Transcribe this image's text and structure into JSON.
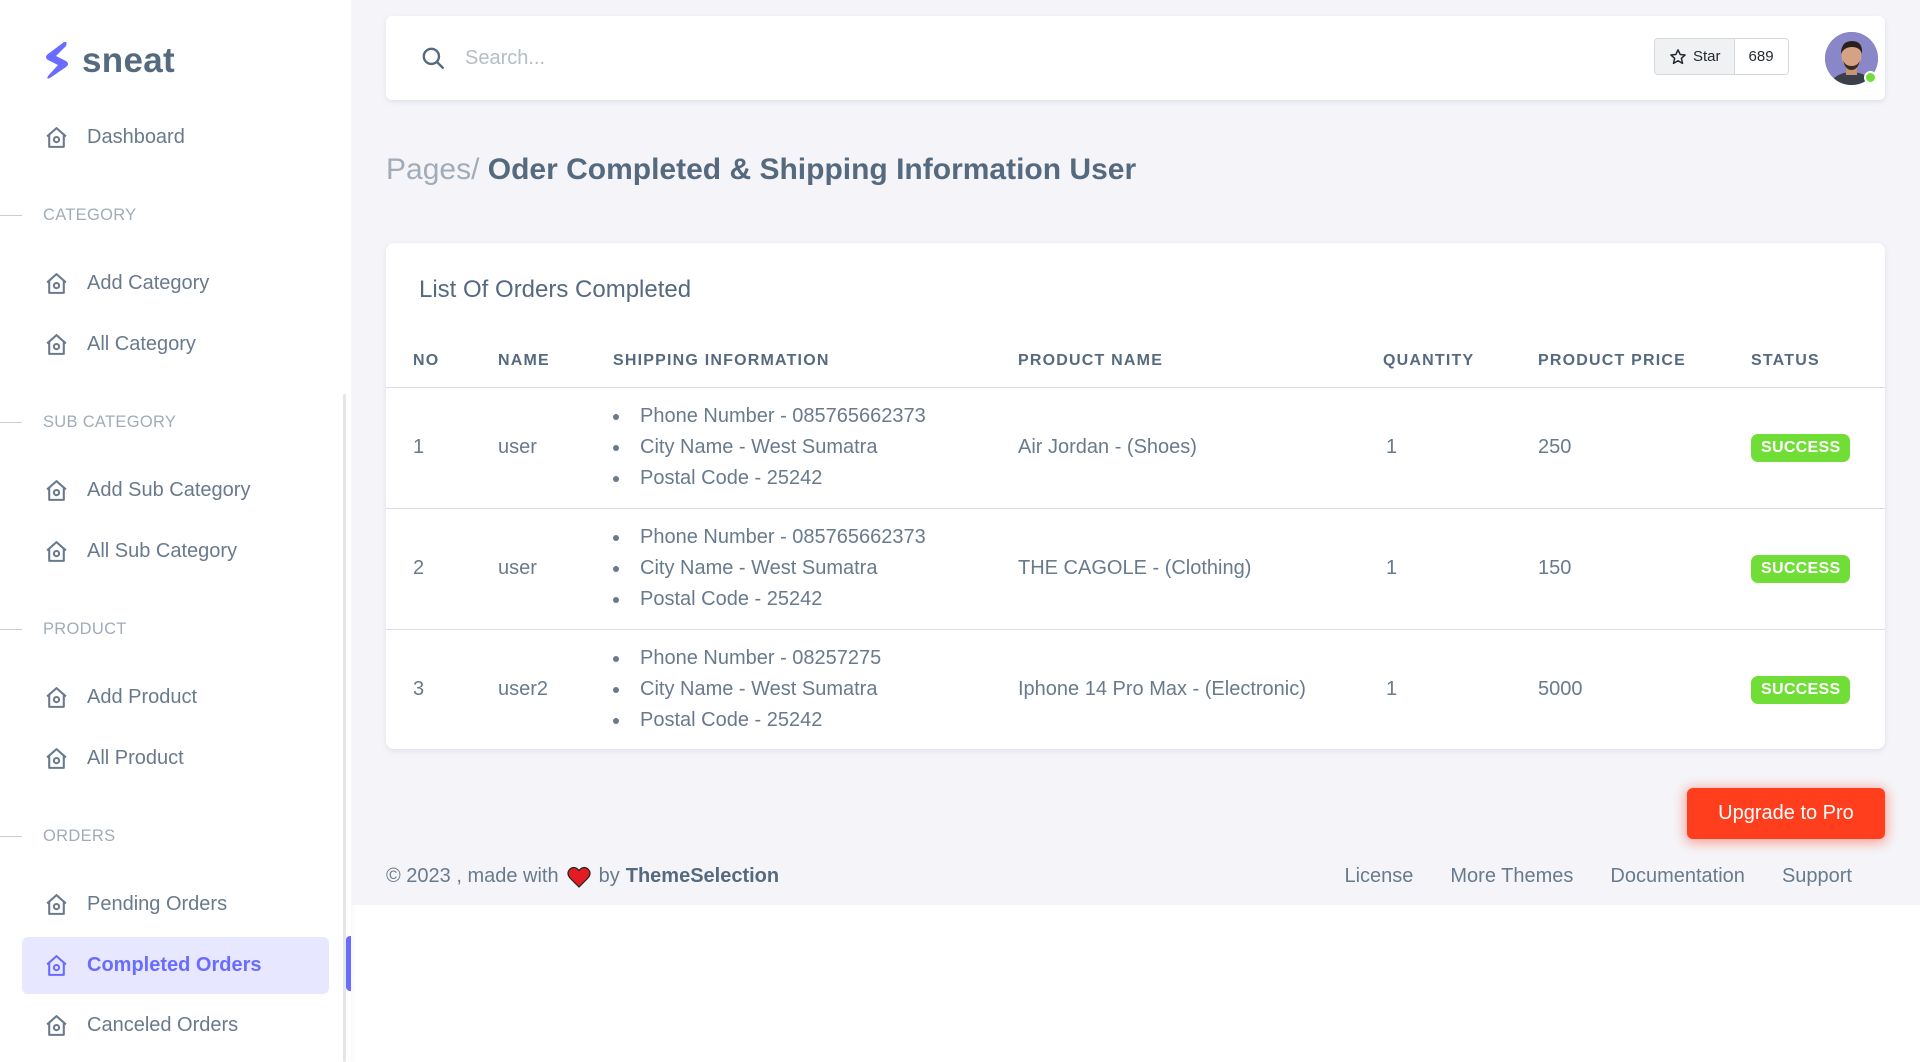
{
  "brand": {
    "name": "sneat"
  },
  "sidebar": {
    "dashboard": "Dashboard",
    "sections": [
      {
        "header": "CATEGORY",
        "items": [
          "Add Category",
          "All Category"
        ]
      },
      {
        "header": "SUB CATEGORY",
        "items": [
          "Add Sub Category",
          "All Sub Category"
        ]
      },
      {
        "header": "PRODUCT",
        "items": [
          "Add Product",
          "All Product"
        ]
      },
      {
        "header": "ORDERS",
        "items": [
          "Pending Orders",
          "Completed Orders",
          "Canceled Orders"
        ]
      }
    ],
    "active_item": "Completed Orders",
    "icon": "home-icon"
  },
  "navbar": {
    "search_placeholder": "Search...",
    "github_star_label": "Star",
    "github_star_count": "689"
  },
  "breadcrumb": {
    "parent": "Pages/",
    "current": "Oder Completed & Shipping Information User"
  },
  "orders_table": {
    "title": "List Of Orders Completed",
    "columns": [
      "NO",
      "NAME",
      "SHIPPING INFORMATION",
      "PRODUCT NAME",
      "QUANTITY",
      "PRODUCT PRICE",
      "STATUS"
    ],
    "rows": [
      {
        "no": "1",
        "name": "user",
        "shipping": [
          "Phone Number - 085765662373",
          "City Name - West Sumatra",
          "Postal Code - 25242"
        ],
        "product": "Air Jordan - (Shoes)",
        "quantity": "1",
        "price": "250",
        "status": "SUCCESS"
      },
      {
        "no": "2",
        "name": "user",
        "shipping": [
          "Phone Number - 085765662373",
          "City Name - West Sumatra",
          "Postal Code - 25242"
        ],
        "product": "THE CAGOLE - (Clothing)",
        "quantity": "1",
        "price": "150",
        "status": "SUCCESS"
      },
      {
        "no": "3",
        "name": "user2",
        "shipping": [
          "Phone Number - 08257275",
          "City Name - West Sumatra",
          "Postal Code - 25242"
        ],
        "product": "Iphone 14 Pro Max - (Electronic)",
        "quantity": "1",
        "price": "5000",
        "status": "SUCCESS"
      }
    ]
  },
  "upgrade_button": "Upgrade to Pro",
  "footer": {
    "copyright": "© 2023 , made with",
    "by": "by",
    "brand": "ThemeSelection",
    "links": [
      "License",
      "More Themes",
      "Documentation",
      "Support"
    ]
  },
  "colors": {
    "primary": "#696cff",
    "success": "#71dd37",
    "danger": "#ff3e1d",
    "text": "#566a7f",
    "background": "#f5f5f9"
  }
}
